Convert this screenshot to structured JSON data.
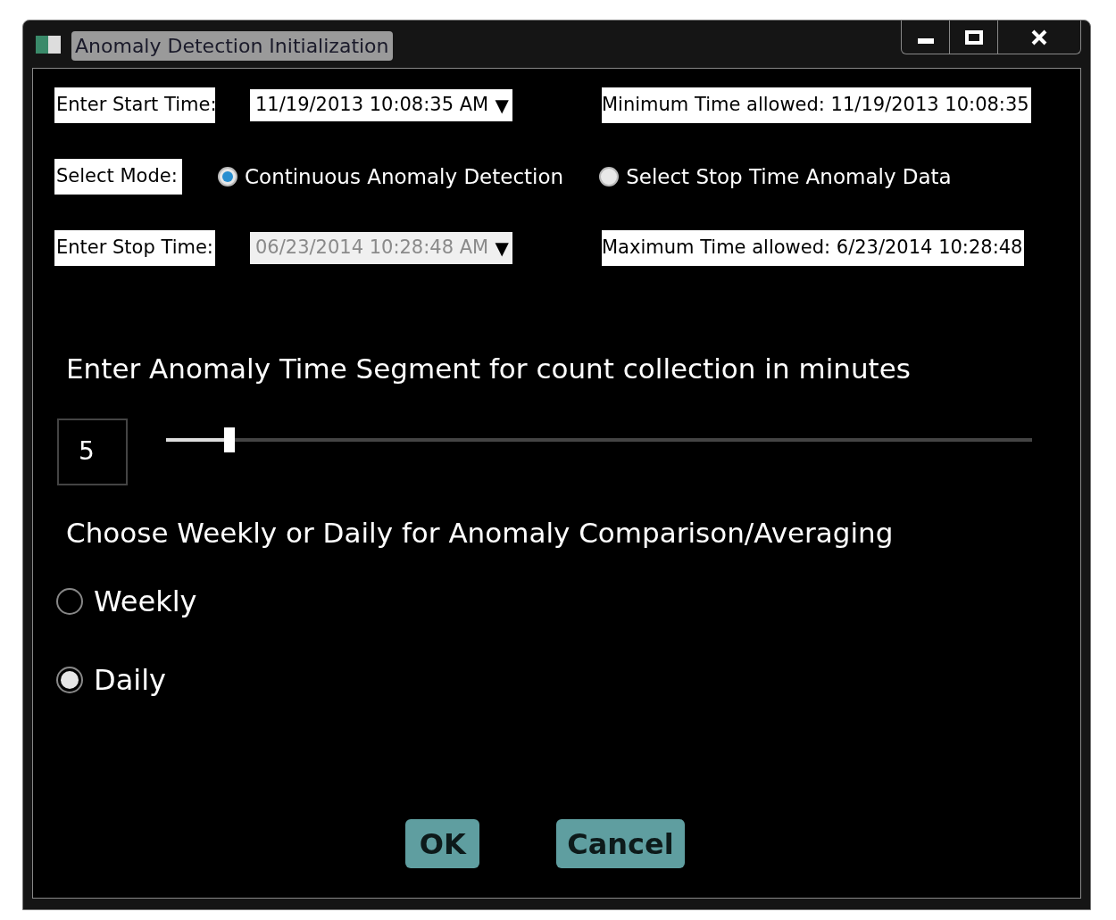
{
  "window": {
    "title": "Anomaly Detection Initialization"
  },
  "start": {
    "label": "Enter Start Time:",
    "value": "11/19/2013 10:08:35 AM",
    "disabled": false,
    "arrow": "▼",
    "limit": "Minimum Time allowed:  11/19/2013 10:08:35"
  },
  "mode": {
    "label": "Select Mode:",
    "options": [
      {
        "label": "Continuous Anomaly Detection",
        "selected": true
      },
      {
        "label": "Select Stop Time Anomaly Data",
        "selected": false
      }
    ]
  },
  "stop": {
    "label": "Enter Stop Time:",
    "value": "06/23/2014 10:28:48 AM",
    "disabled": true,
    "arrow": "▼",
    "limit": "Maximum Time allowed:  6/23/2014 10:28:48"
  },
  "segment": {
    "heading": "Enter Anomaly Time Segment for count collection in minutes",
    "value": "5",
    "level": 0.073
  },
  "comparison": {
    "heading": "Choose Weekly or Daily for Anomaly Comparison/Averaging",
    "options": [
      {
        "label": "Weekly",
        "selected": false
      },
      {
        "label": "Daily",
        "selected": true
      }
    ]
  },
  "buttons": [
    "OK",
    "Cancel"
  ]
}
